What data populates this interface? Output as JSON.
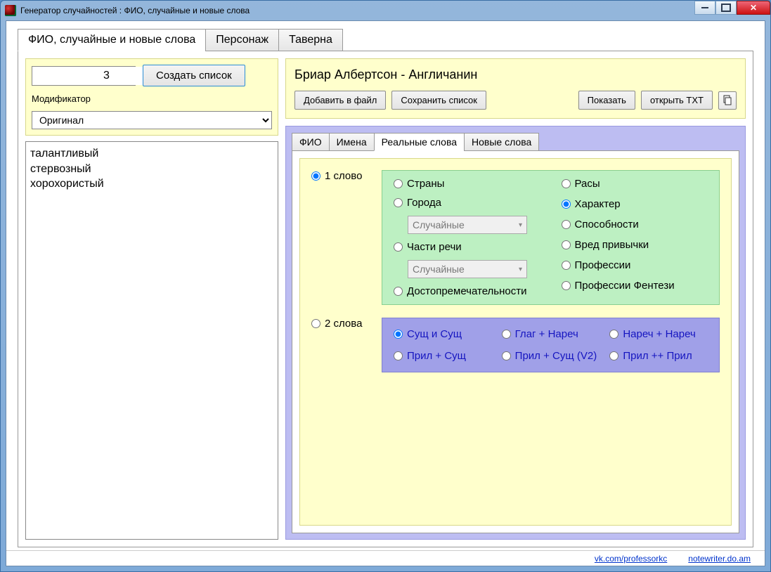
{
  "window": {
    "title": "Генератор случайностей : ФИО, случайные и новые слова"
  },
  "tabs_main": {
    "t0": "ФИО, случайные и новые слова",
    "t1": "Персонаж",
    "t2": "Таверна"
  },
  "left": {
    "count_value": "3",
    "create_button": "Создать список",
    "modifier_label": "Модификатор",
    "modifier_value": "Оригинал",
    "result_text": "талантливый\nстервозный\nхорохористый"
  },
  "right_top": {
    "heading": "Бриар Албертсон - Англичанин",
    "btn_add": "Добавить в файл",
    "btn_save": "Сохранить список",
    "btn_show": "Показать",
    "btn_open": "открыть TXT"
  },
  "inner_tabs": {
    "t0": "ФИО",
    "t1": "Имена",
    "t2": "Реальные слова",
    "t3": "Новые слова"
  },
  "words_panel": {
    "one_word": "1 слово",
    "two_words": "2 слова",
    "cat": {
      "countries": "Страны",
      "cities": "Города",
      "parts": "Части речи",
      "sights": "Достопремечательности",
      "races": "Расы",
      "character": "Характер",
      "abilities": "Способности",
      "habits": "Вред привычки",
      "prof": "Профессии",
      "prof_fantasy": "Профессии Фентези"
    },
    "random_opt": "Случайные",
    "combo2": {
      "c0": "Сущ и Сущ",
      "c1": "Глаг + Нареч",
      "c2": "Нареч + Нареч",
      "c3": "Прил + Сущ",
      "c4": "Прил + Сущ (V2)",
      "c5": "Прил ++ Прил"
    }
  },
  "footer": {
    "link1": "vk.com/professorkc",
    "link2": "notewriter.do.am"
  }
}
